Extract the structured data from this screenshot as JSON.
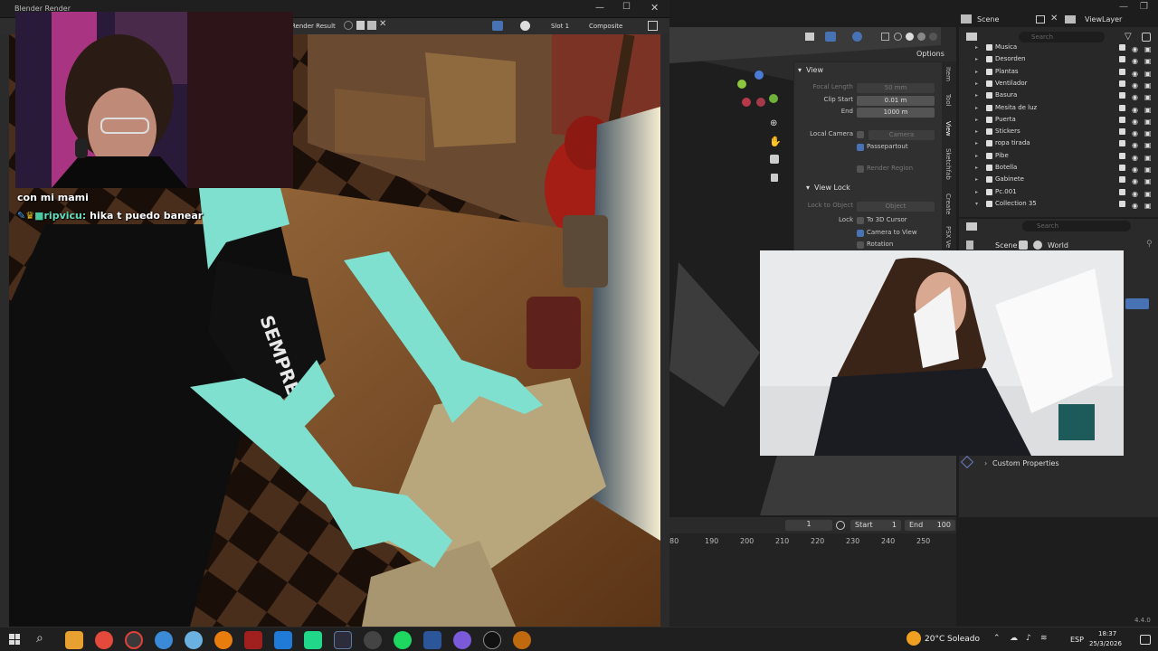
{
  "render_window": {
    "title": "Blender Render",
    "toolbar": {
      "result_label": "Render Result",
      "slot": "Slot 1",
      "pass": "Composite"
    }
  },
  "chat": {
    "line1": "con mi mami",
    "line2_user": "ripvicu:",
    "line2_msg": "hika t puedo banear"
  },
  "header": {
    "scene_label": "Scene",
    "view_layer_label": "ViewLayer",
    "options_label": "Options",
    "search_placeholder": "Search"
  },
  "npanel": {
    "view_title": "View",
    "focal_length_label": "Focal Length",
    "focal_length_value": "50 mm",
    "clip_start_label": "Clip Start",
    "clip_start_value": "0.01 m",
    "clip_end_label": "End",
    "clip_end_value": "1000 m",
    "local_camera_label": "Local Camera",
    "local_camera_value": "Camera",
    "passepartout_label": "Passepartout",
    "render_region_label": "Render Region",
    "view_lock_title": "View Lock",
    "lock_to_object_label": "Lock to Object",
    "lock_to_object_value": "Object",
    "lock_label": "Lock",
    "to_3d_cursor_label": "To 3D Cursor",
    "camera_to_view_label": "Camera to View",
    "rotation_label": "Rotation",
    "tabs": [
      "Item",
      "Tool",
      "View",
      "Sketchfab",
      "Create",
      "PSX Ve"
    ]
  },
  "outliner": {
    "items": [
      {
        "name": "Musica",
        "tri": "▸"
      },
      {
        "name": "Desorden",
        "tri": "▸"
      },
      {
        "name": "Plantas",
        "tri": "▸"
      },
      {
        "name": "Ventilador",
        "tri": "▸"
      },
      {
        "name": "Basura",
        "tri": "▸"
      },
      {
        "name": "Mesita de luz",
        "tri": "▸"
      },
      {
        "name": "Puerta",
        "tri": "▸"
      },
      {
        "name": "Stickers",
        "tri": "▸"
      },
      {
        "name": "ropa tirada",
        "tri": "▸"
      },
      {
        "name": "Pibe",
        "tri": "▸"
      },
      {
        "name": "Botella",
        "tri": "▸"
      },
      {
        "name": "Gabinete",
        "tri": "▸"
      },
      {
        "name": "Pc.001",
        "tri": "▸"
      },
      {
        "name": "Collection 35",
        "tri": "▾"
      }
    ]
  },
  "properties": {
    "breadcrumb_scene": "Scene",
    "breadcrumb_world": "World",
    "custom_properties_label": "Custom Properties"
  },
  "timeline": {
    "current_frame": "1",
    "start_label": "Start",
    "start_value": "1",
    "end_label": "End",
    "end_value": "100",
    "ticks": [
      "80",
      "190",
      "200",
      "210",
      "220",
      "230",
      "240",
      "250"
    ]
  },
  "status": {
    "version": "4.4.0"
  },
  "taskbar": {
    "weather_temp": "20°C",
    "weather_text": "Soleado",
    "language": "ESP",
    "time": "18:37",
    "date": "25/3/2026"
  },
  "colors": {
    "blender_accent": "#4772b3",
    "teal_skin": "#7fe0d0",
    "outliner_orange": "#e8a050"
  }
}
